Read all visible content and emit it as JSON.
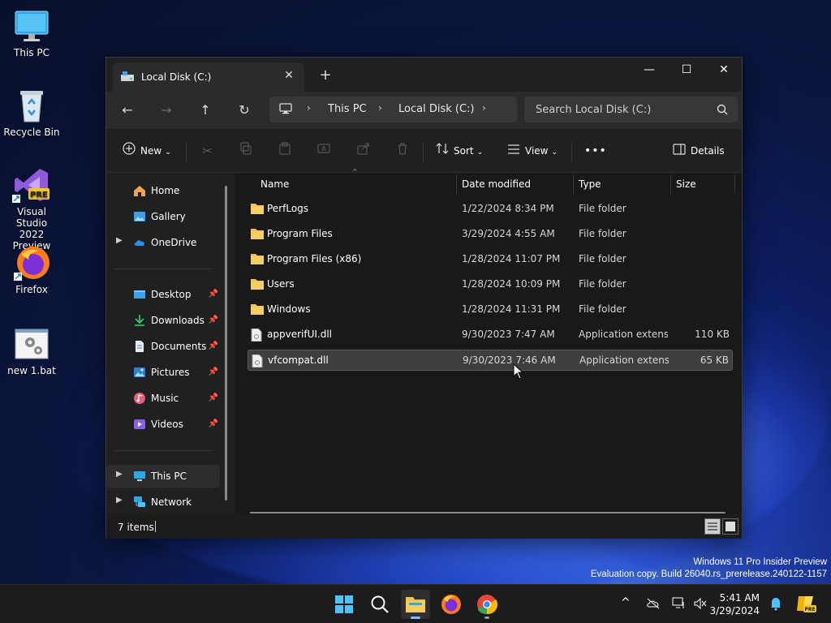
{
  "desktop": {
    "icons": [
      {
        "label": "This PC"
      },
      {
        "label": "Recycle Bin"
      },
      {
        "label": "Visual Studio\n2022 Preview",
        "badge": "PRE"
      },
      {
        "label": "Firefox"
      },
      {
        "label": "new 1.bat"
      }
    ]
  },
  "window": {
    "tab_title": "Local Disk (C:)",
    "tab_close": "✕",
    "new_tab": "+",
    "controls": {
      "minimize": "—",
      "maximize": "☐",
      "close": "✕"
    }
  },
  "navbar": {
    "back": "←",
    "forward": "→",
    "up": "↑",
    "refresh": "↻",
    "breadcrumb": [
      "This PC",
      "Local Disk (C:)"
    ],
    "search_placeholder": "Search Local Disk (C:)"
  },
  "commandbar": {
    "new_label": "New",
    "sort_label": "Sort",
    "view_label": "View",
    "more_label": "•••",
    "details_label": "Details"
  },
  "sidebar": {
    "items": [
      {
        "label": "Home"
      },
      {
        "label": "Gallery"
      },
      {
        "label": "OneDrive"
      },
      {
        "label": "Desktop"
      },
      {
        "label": "Downloads"
      },
      {
        "label": "Documents"
      },
      {
        "label": "Pictures"
      },
      {
        "label": "Music"
      },
      {
        "label": "Videos"
      },
      {
        "label": "This PC"
      },
      {
        "label": "Network"
      }
    ]
  },
  "table": {
    "columns": {
      "name": "Name",
      "date": "Date modified",
      "type": "Type",
      "size": "Size"
    },
    "rows": [
      {
        "name": "PerfLogs",
        "date": "1/22/2024 8:34 PM",
        "type": "File folder",
        "size": "",
        "icon": "folder-icon"
      },
      {
        "name": "Program Files",
        "date": "3/29/2024 4:55 AM",
        "type": "File folder",
        "size": "",
        "icon": "folder-icon"
      },
      {
        "name": "Program Files (x86)",
        "date": "1/28/2024 11:07 PM",
        "type": "File folder",
        "size": "",
        "icon": "folder-icon"
      },
      {
        "name": "Users",
        "date": "1/28/2024 10:09 PM",
        "type": "File folder",
        "size": "",
        "icon": "folder-icon"
      },
      {
        "name": "Windows",
        "date": "1/28/2024 11:31 PM",
        "type": "File folder",
        "size": "",
        "icon": "folder-icon"
      },
      {
        "name": "appverifUI.dll",
        "date": "9/30/2023 7:47 AM",
        "type": "Application extens...",
        "size": "110 KB",
        "icon": "dll-file-icon"
      },
      {
        "name": "vfcompat.dll",
        "date": "9/30/2023 7:46 AM",
        "type": "Application extens...",
        "size": "65 KB",
        "icon": "dll-file-icon"
      }
    ]
  },
  "status": {
    "items_count": "7 items"
  },
  "watermark": {
    "line1": "Windows 11 Pro Insider Preview",
    "line2": "Evaluation copy. Build 26040.rs_prerelease.240122-1157"
  },
  "taskbar": {
    "time": "5:41 AM",
    "date": "3/29/2024",
    "tray_chevron": "^"
  },
  "colors": {
    "folder": "#f2c14e",
    "accent": "#4cc2ff",
    "window_bg": "#191919"
  }
}
